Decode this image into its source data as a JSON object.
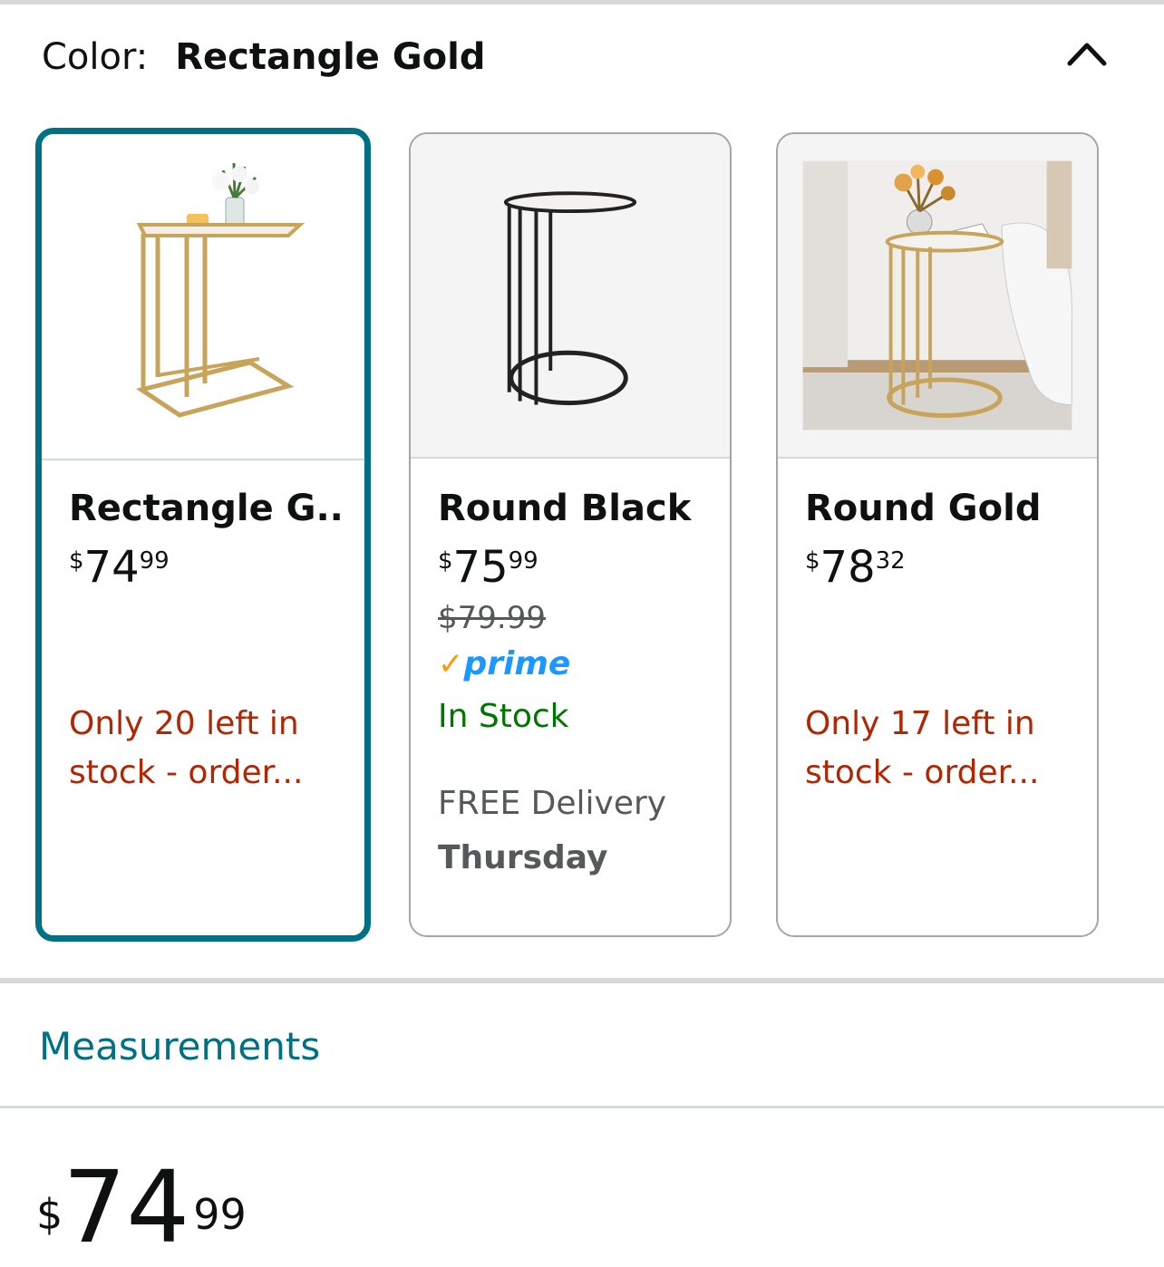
{
  "color_selector": {
    "label": "Color:",
    "selected_value": "Rectangle Gold",
    "collapse_icon": "chevron-up-icon"
  },
  "variants": [
    {
      "name": "Rectangle G...",
      "price_symbol": "$",
      "price_whole": "74",
      "price_cents": "99",
      "availability_line1": "Only 20 left in",
      "availability_line2": "stock - order...",
      "selected": true
    },
    {
      "name": "Round Black",
      "price_symbol": "$",
      "price_whole": "75",
      "price_cents": "99",
      "list_price": "$79.99",
      "prime_check": "✓",
      "prime_label": "prime",
      "availability": "In Stock",
      "delivery_line1": "FREE Delivery",
      "delivery_line2": "Thursday",
      "selected": false
    },
    {
      "name": "Round Gold",
      "price_symbol": "$",
      "price_whole": "78",
      "price_cents": "32",
      "availability_line1": "Only 17 left in",
      "availability_line2": "stock - order...",
      "selected": false
    }
  ],
  "measurements_link": "Measurements",
  "main_price": {
    "symbol": "$",
    "whole": "74",
    "cents": "99"
  },
  "colors": {
    "accent": "#007185",
    "low_stock": "#b12704",
    "in_stock": "#007600",
    "prime_blue": "#1a98ff",
    "prime_check": "#ff9900"
  }
}
